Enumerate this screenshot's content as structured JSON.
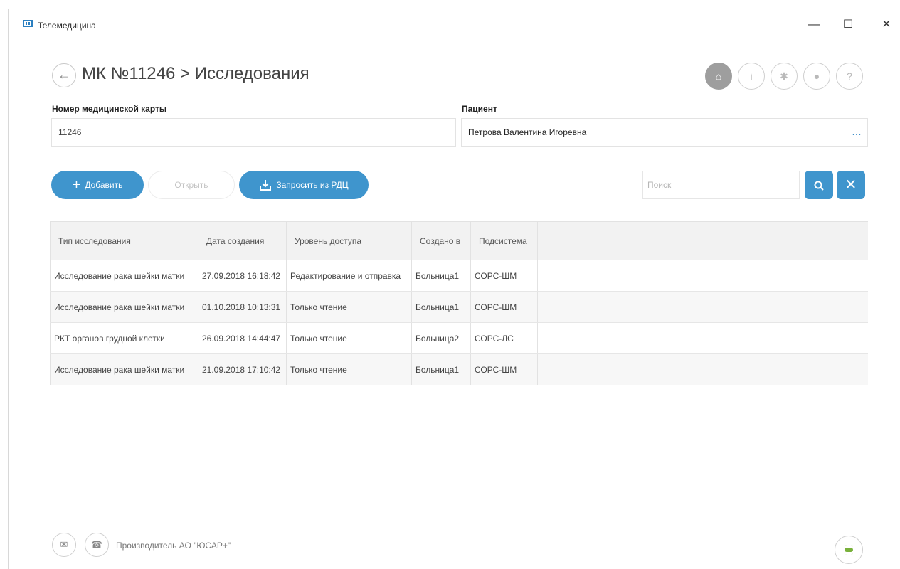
{
  "window": {
    "title": "Телемедицина",
    "minimize": "—",
    "maximize": "☐",
    "close": "✕"
  },
  "header": {
    "back_icon": "←",
    "title": "МК №11246 > Исследования",
    "icons": [
      {
        "name": "home-icon",
        "glyph": "⌂",
        "active": true
      },
      {
        "name": "info-icon",
        "glyph": "i",
        "active": false
      },
      {
        "name": "gear-icon",
        "glyph": "✱",
        "active": false
      },
      {
        "name": "user-icon",
        "glyph": "●",
        "active": false
      },
      {
        "name": "help-icon",
        "glyph": "?",
        "active": false
      }
    ]
  },
  "fields": {
    "card_label": "Номер медицинской карты",
    "card_value": "11246",
    "patient_label": "Пациент",
    "patient_value": "Петрова Валентина Игоревна",
    "patient_more": "..."
  },
  "toolbar": {
    "add_label": "Добавить",
    "open_label": "Открыть",
    "request_label": "Запросить из РДЦ",
    "search_placeholder": "Поиск",
    "search_icon": "⌕",
    "clear_icon": "✕"
  },
  "table": {
    "columns": [
      "Тип исследования",
      "Дата создания",
      "Уровень доступа",
      "Создано в",
      "Подсистема"
    ],
    "rows": [
      [
        "Исследование рака шейки матки",
        "27.09.2018 16:18:42",
        "Редактирование и отправка",
        "Больница1",
        "СОРС-ШМ"
      ],
      [
        "Исследование рака шейки матки",
        "01.10.2018 10:13:31",
        "Только чтение",
        "Больница1",
        "СОРС-ШМ"
      ],
      [
        "РКТ органов грудной клетки",
        "26.09.2018 14:44:47",
        "Только чтение",
        "Больница2",
        "СОРС-ЛС"
      ],
      [
        "Исследование рака шейки матки",
        "21.09.2018 17:10:42",
        "Только чтение",
        "Больница1",
        "СОРС-ШМ"
      ]
    ]
  },
  "footer": {
    "mail_icon": "✉",
    "phone_icon": "☎",
    "manufacturer": "Производитель АО \"ЮСАР+\""
  },
  "colors": {
    "accent": "#3f95cd",
    "active_icon": "#9e9e9e",
    "db_icon": "#79b13b"
  }
}
